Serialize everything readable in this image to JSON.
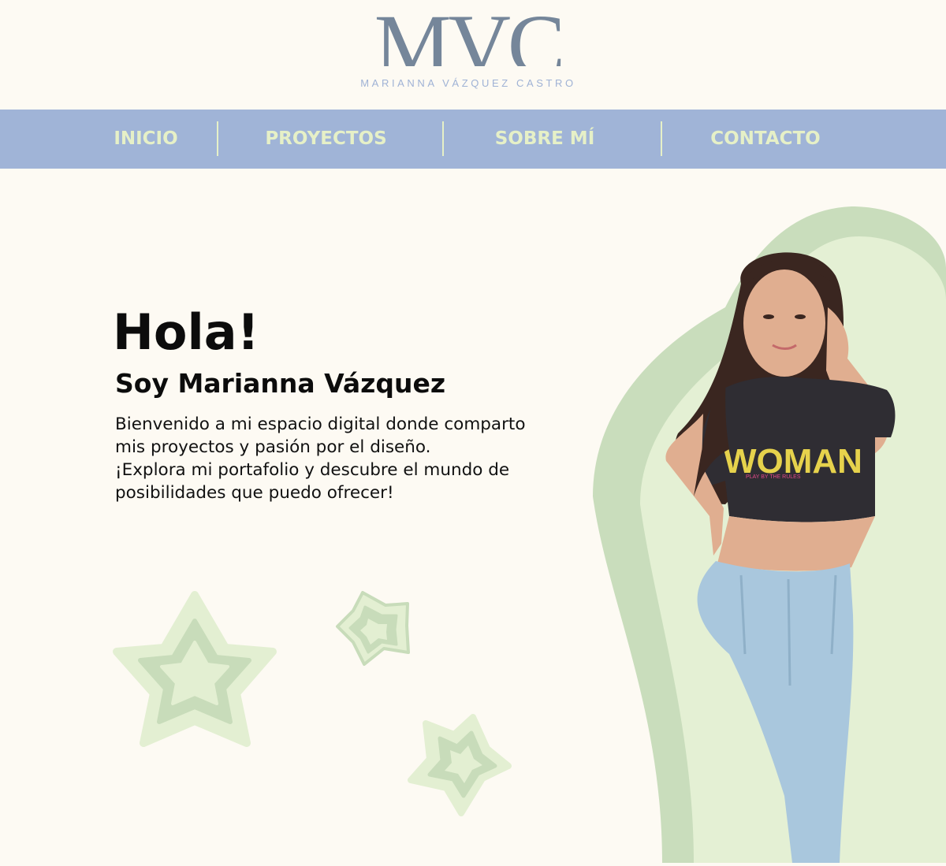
{
  "brand": {
    "mark": "MVC",
    "name": "MARIANNA VÁZQUEZ CASTRO",
    "mark_color": "#75869a",
    "name_color": "#9fb2d5"
  },
  "nav": {
    "background": "#a0b4d7",
    "text_color": "#e6f0c7",
    "items": [
      {
        "label": "INICIO"
      },
      {
        "label": "PROYECTOS"
      },
      {
        "label": "SOBRE MÍ"
      },
      {
        "label": "CONTACTO"
      }
    ]
  },
  "hero": {
    "title": "Hola!",
    "subtitle": "Soy Marianna Vázquez",
    "paragraph_1": "Bienvenido a mi espacio digital donde comparto mis proyectos y pasión por el diseño.",
    "paragraph_2": "¡Explora mi portafolio y descubre el mundo de posibilidades que puedo ofrecer!"
  },
  "photo": {
    "shirt_text": "WOMAN",
    "shirt_subtext": "PLAY BY THE RULES"
  },
  "colors": {
    "page_bg": "#fdfaf3",
    "green_light": "#e3efd2",
    "green_mid": "#c8dcba",
    "hair": "#3a2620",
    "skin": "#e0ae90",
    "shirt": "#2f2d33",
    "jeans": "#a9c7dd"
  }
}
